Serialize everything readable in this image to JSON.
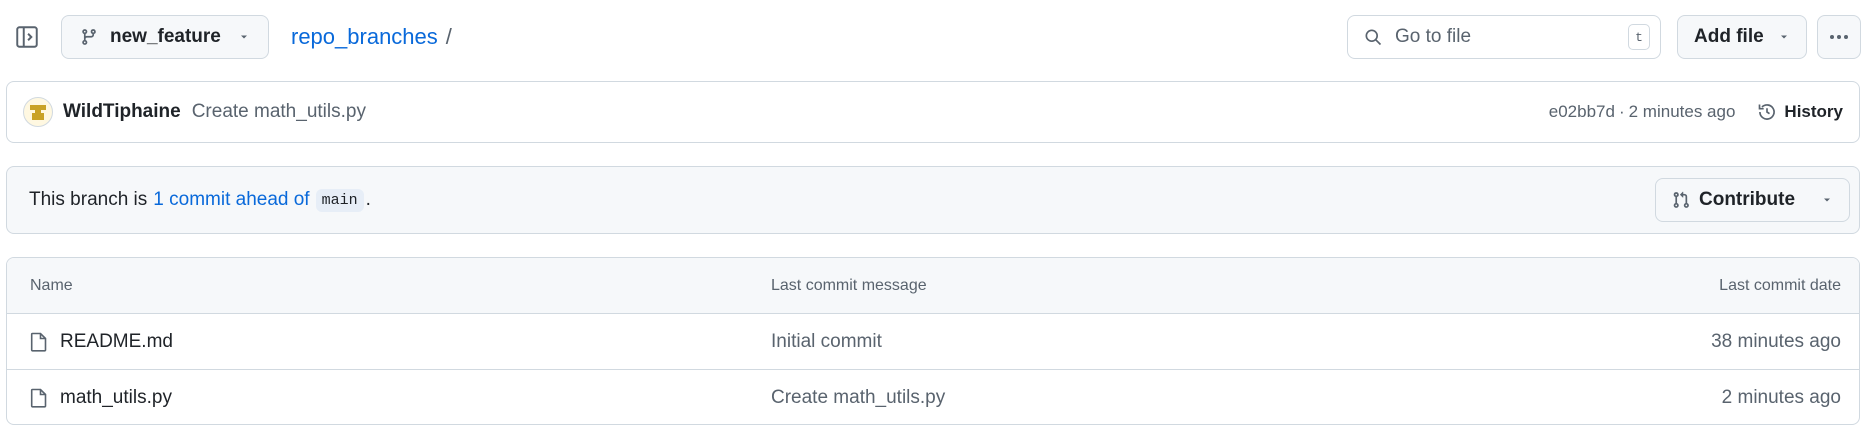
{
  "topbar": {
    "branch_name": "new_feature",
    "repo_name": "repo_branches",
    "path_separator": "/",
    "search_placeholder": "Go to file",
    "search_shortcut": "t",
    "add_file_label": "Add file"
  },
  "commit": {
    "author": "WildTiphaine",
    "message": "Create math_utils.py",
    "sha": "e02bb7d",
    "separator": "·",
    "time": "2 minutes ago",
    "history_label": "History"
  },
  "branch_info": {
    "prefix": "This branch is",
    "ahead_text": "1 commit ahead of",
    "base_branch": "main",
    "suffix": ".",
    "contribute_label": "Contribute"
  },
  "file_table": {
    "headers": {
      "name": "Name",
      "message": "Last commit message",
      "date": "Last commit date"
    },
    "rows": [
      {
        "name": "README.md",
        "message": "Initial commit",
        "date": "38 minutes ago"
      },
      {
        "name": "math_utils.py",
        "message": "Create math_utils.py",
        "date": "2 minutes ago"
      }
    ]
  },
  "colors": {
    "link": "#0969da",
    "muted": "#59636e",
    "border": "#d1d9e0",
    "subtle_bg": "#f6f8fa"
  }
}
